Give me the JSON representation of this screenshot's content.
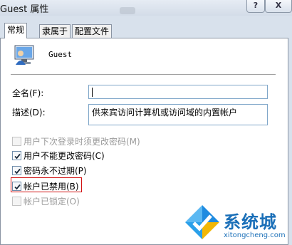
{
  "window": {
    "title": "Guest 属性",
    "help_label": "?",
    "close_label": "X"
  },
  "tabs": [
    {
      "label": "常规",
      "active": true
    },
    {
      "label": "隶属于",
      "active": false
    },
    {
      "label": "配置文件",
      "active": false
    }
  ],
  "general": {
    "user_name": "Guest",
    "full_name_label": "全名(F):",
    "full_name_value": "",
    "description_label": "描述(D):",
    "description_value": "供来宾访问计算机或访问域的内置帐户"
  },
  "options": [
    {
      "label": "用户下次登录时须更改密码(M)",
      "checked": false,
      "enabled": false
    },
    {
      "label": "用户不能更改密码(C)",
      "checked": true,
      "enabled": true
    },
    {
      "label": "密码永不过期(P)",
      "checked": true,
      "enabled": true
    },
    {
      "label": "帐户已禁用(B)",
      "checked": true,
      "enabled": true,
      "highlighted": true
    },
    {
      "label": "帐户已锁定(O)",
      "checked": false,
      "enabled": false
    }
  ],
  "watermark": {
    "text": "系统城",
    "url": "xitongcheng.com"
  },
  "colors": {
    "highlight_border": "#d21414",
    "watermark_blue": "#1a6fb8"
  }
}
